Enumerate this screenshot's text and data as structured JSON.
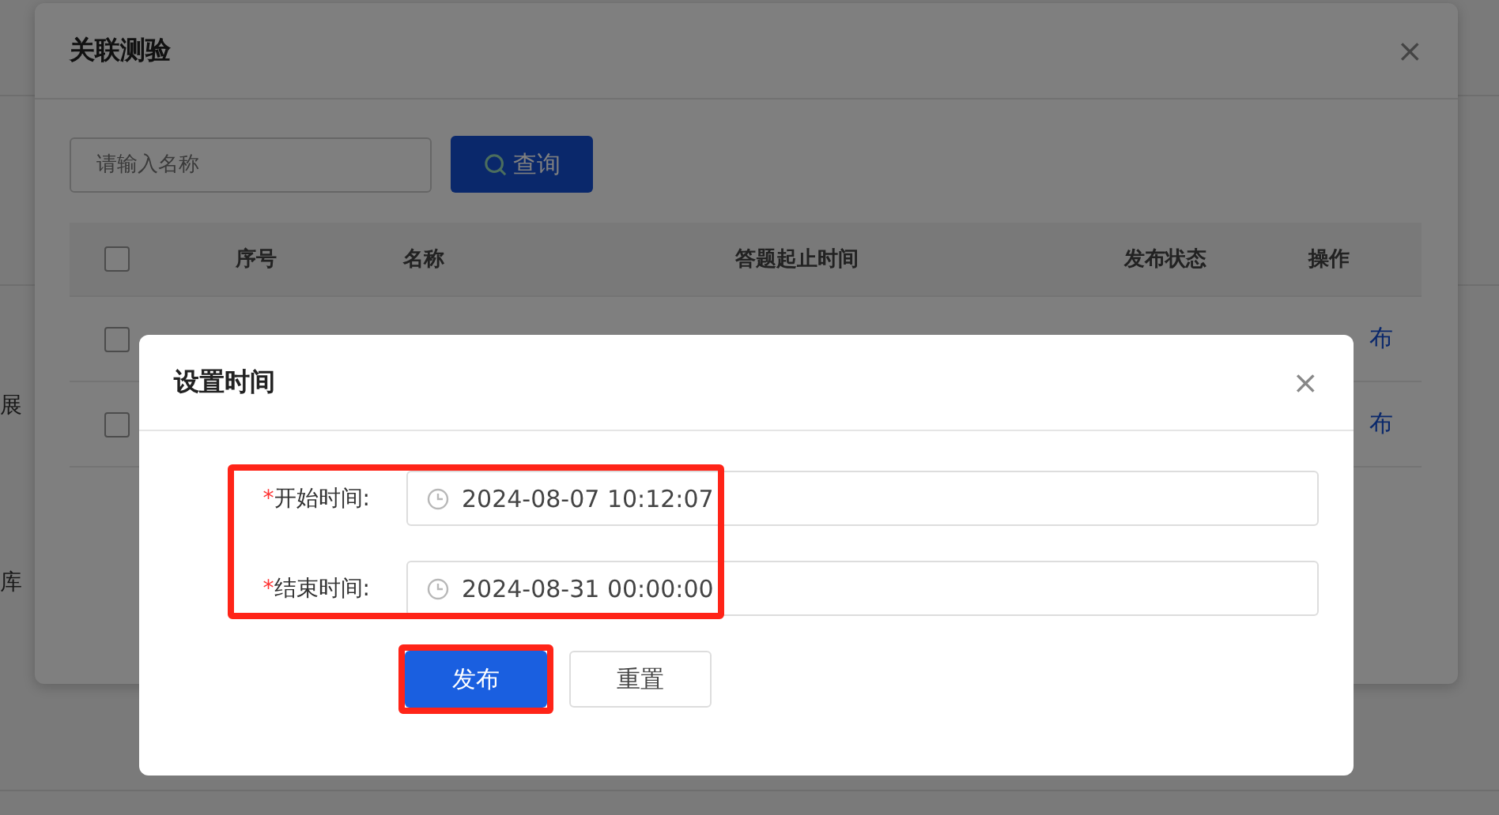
{
  "page": {
    "texts": [
      "展",
      "库"
    ]
  },
  "outer_dialog": {
    "title": "关联测验",
    "close": "×",
    "search": {
      "placeholder": "请输入名称"
    },
    "search_button": "查询",
    "table": {
      "columns": [
        "序号",
        "名称",
        "答题起止时间",
        "发布状态",
        "操作"
      ],
      "header_checked": false,
      "rows": [
        {
          "checked": false,
          "action": "布"
        },
        {
          "checked": false,
          "action": "布"
        }
      ]
    }
  },
  "dialog": {
    "title": "设置时间",
    "close": "×",
    "highlight_fields": true,
    "fields": [
      {
        "label": "开始时间:",
        "required_mark": "*",
        "value": "2024-08-07 10:12:07"
      },
      {
        "label": "结束时间:",
        "required_mark": "*",
        "value": "2024-08-31 00:00:00"
      }
    ],
    "buttons": [
      {
        "label": "发布",
        "kind": "primary",
        "highlight": true
      },
      {
        "label": "重置",
        "kind": "default",
        "highlight": false
      }
    ]
  }
}
